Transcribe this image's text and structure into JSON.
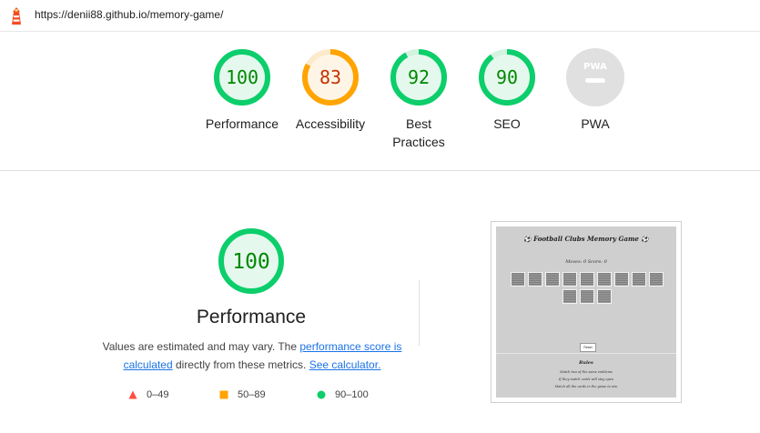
{
  "topbar": {
    "url": "https://denii88.github.io/memory-game/"
  },
  "colors": {
    "pass": "#0cce6b",
    "pass_text": "#008800",
    "pass_fill": "#e5f8ee",
    "average": "#ffa400",
    "average_text": "#c33300",
    "average_fill": "#fff5e6",
    "fail": "#ff4e42",
    "na": "#e0e0e0"
  },
  "gauges": [
    {
      "id": "performance",
      "score": "100",
      "value": 100,
      "label": "Performance",
      "rating": "pass"
    },
    {
      "id": "accessibility",
      "score": "83",
      "value": 83,
      "label": "Accessibility",
      "rating": "average"
    },
    {
      "id": "best-practices",
      "score": "92",
      "value": 92,
      "label": "Best Practices",
      "rating": "pass"
    },
    {
      "id": "seo",
      "score": "90",
      "value": 90,
      "label": "SEO",
      "rating": "pass"
    },
    {
      "id": "pwa",
      "score": "PWA",
      "value": null,
      "label": "PWA",
      "rating": "na"
    }
  ],
  "main": {
    "score": "100",
    "title": "Performance",
    "desc_part1": "Values are estimated and may vary. The ",
    "desc_link1": "performance score is calculated",
    "desc_part2": " directly from these metrics. ",
    "desc_link2": "See calculator."
  },
  "legend": [
    {
      "icon": "triangle-icon",
      "range": "0–49"
    },
    {
      "icon": "square-icon",
      "range": "50–89"
    },
    {
      "icon": "circle-icon",
      "range": "90–100"
    }
  ],
  "screenshot": {
    "title": "⚽ Football Clubs Memory Game ⚽",
    "score": "Moves: 0  Score: 0",
    "reset_label": "Reset",
    "rules_title": "Rules",
    "rules": [
      "Match two of the same emblems",
      "If they match cards will stay open",
      "Match all the cards in the game to win"
    ]
  }
}
